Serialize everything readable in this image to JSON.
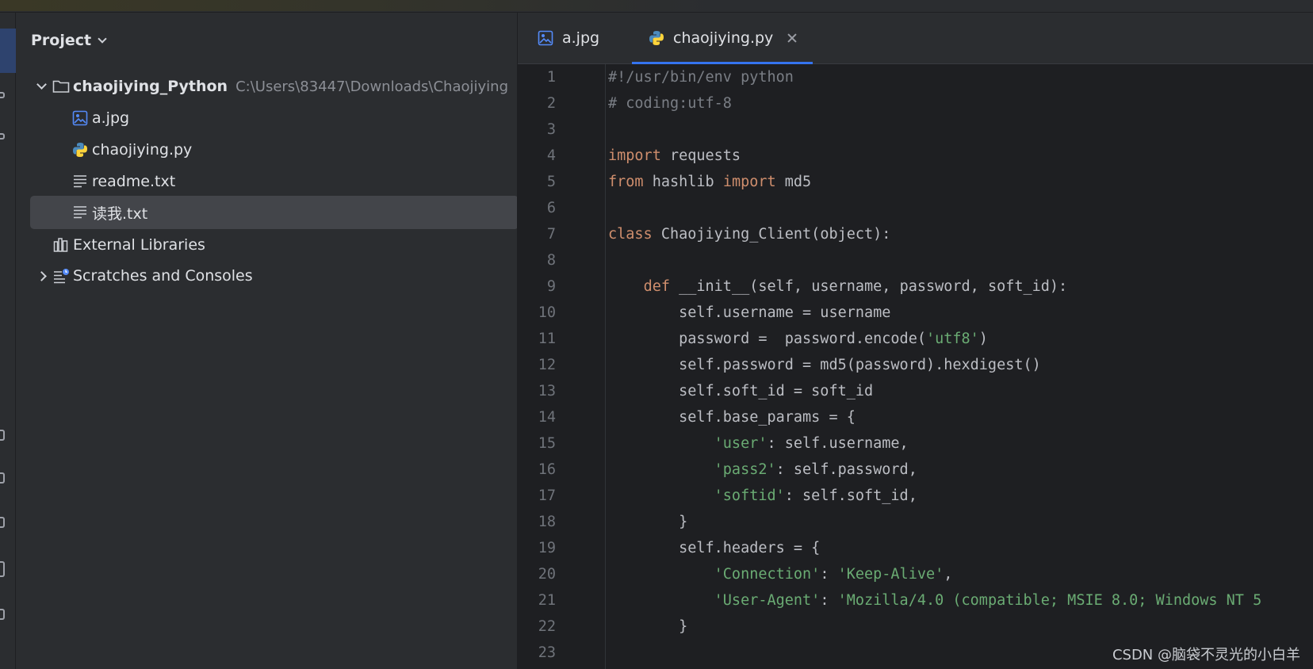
{
  "project_panel": {
    "title": "Project",
    "root": {
      "name": "chaojiying_Python",
      "path": "C:\\Users\\83447\\Downloads\\Chaojiying"
    },
    "files": [
      {
        "name": "a.jpg",
        "icon": "image-file-icon"
      },
      {
        "name": "chaojiying.py",
        "icon": "python-file-icon"
      },
      {
        "name": "readme.txt",
        "icon": "text-file-icon"
      },
      {
        "name": "读我.txt",
        "icon": "text-file-icon",
        "selected": true
      }
    ],
    "external_libraries": "External Libraries",
    "scratches": "Scratches and Consoles"
  },
  "tabs": [
    {
      "label": "a.jpg",
      "icon": "image-file-icon",
      "active": false
    },
    {
      "label": "chaojiying.py",
      "icon": "python-file-icon",
      "active": true
    }
  ],
  "editor": {
    "line_numbers": [
      "1",
      "2",
      "3",
      "4",
      "5",
      "6",
      "7",
      "8",
      "9",
      "10",
      "11",
      "12",
      "13",
      "14",
      "15",
      "16",
      "17",
      "18",
      "19",
      "20",
      "21",
      "22",
      "23"
    ],
    "lines": [
      [
        [
          "c",
          "#!/usr/bin/env python"
        ]
      ],
      [
        [
          "c",
          "# coding:utf-8"
        ]
      ],
      [],
      [
        [
          "k",
          "import"
        ],
        [
          "n",
          " requests"
        ]
      ],
      [
        [
          "k",
          "from"
        ],
        [
          "n",
          " hashlib "
        ],
        [
          "k",
          "import"
        ],
        [
          "n",
          " md5"
        ]
      ],
      [],
      [
        [
          "k",
          "class"
        ],
        [
          "n",
          " Chaojiying_Client(object):"
        ]
      ],
      [],
      [
        [
          "n",
          "    "
        ],
        [
          "k",
          "def"
        ],
        [
          "n",
          " __init__(self, username, password, soft_id):"
        ]
      ],
      [
        [
          "n",
          "        self.username = username"
        ]
      ],
      [
        [
          "n",
          "        password =  password.encode("
        ],
        [
          "s",
          "'utf8'"
        ],
        [
          "n",
          ")"
        ]
      ],
      [
        [
          "n",
          "        self.password = md5(password).hexdigest()"
        ]
      ],
      [
        [
          "n",
          "        self.soft_id = soft_id"
        ]
      ],
      [
        [
          "n",
          "        self.base_params = {"
        ]
      ],
      [
        [
          "n",
          "            "
        ],
        [
          "s",
          "'user'"
        ],
        [
          "n",
          ": self.username,"
        ]
      ],
      [
        [
          "n",
          "            "
        ],
        [
          "s",
          "'pass2'"
        ],
        [
          "n",
          ": self.password,"
        ]
      ],
      [
        [
          "n",
          "            "
        ],
        [
          "s",
          "'softid'"
        ],
        [
          "n",
          ": self.soft_id,"
        ]
      ],
      [
        [
          "n",
          "        }"
        ]
      ],
      [
        [
          "n",
          "        self.headers = {"
        ]
      ],
      [
        [
          "n",
          "            "
        ],
        [
          "s",
          "'Connection'"
        ],
        [
          "n",
          ": "
        ],
        [
          "s",
          "'Keep-Alive'"
        ],
        [
          "n",
          ","
        ]
      ],
      [
        [
          "n",
          "            "
        ],
        [
          "s",
          "'User-Agent'"
        ],
        [
          "n",
          ": "
        ],
        [
          "s",
          "'Mozilla/4.0 (compatible; MSIE 8.0; Windows NT 5"
        ]
      ],
      [
        [
          "n",
          "        }"
        ]
      ],
      []
    ]
  },
  "watermark": "CSDN @脑袋不灵光的小白羊",
  "colors": {
    "keyword": "#cf8e6d",
    "string": "#6aab73",
    "comment": "#7a7e85",
    "accent": "#3574f0"
  }
}
